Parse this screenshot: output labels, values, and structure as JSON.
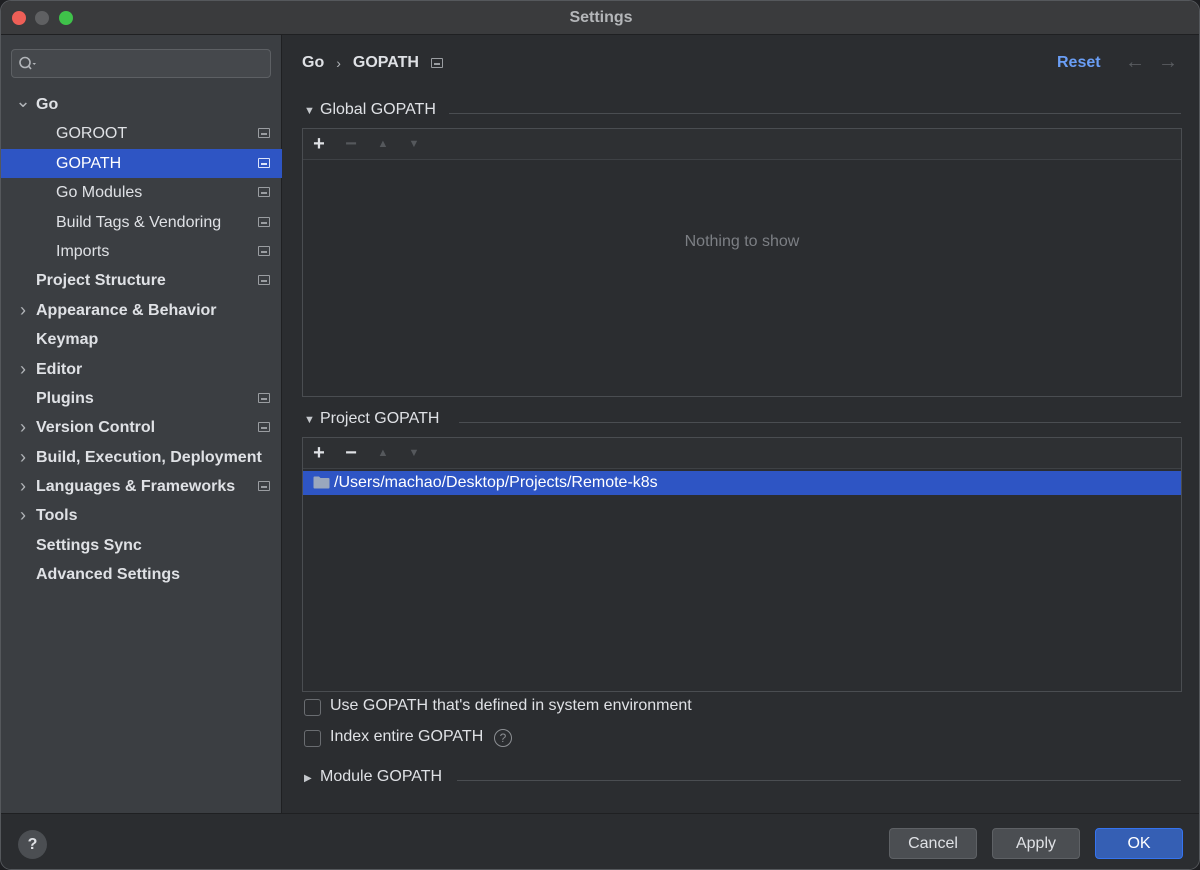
{
  "window": {
    "title": "Settings"
  },
  "sidebar": {
    "search": {
      "value": "",
      "placeholder": ""
    },
    "tree": [
      {
        "label": "Go",
        "bold": true,
        "expander": "expanded",
        "level": 0
      },
      {
        "label": "GOROOT",
        "bold": false,
        "level": 1,
        "project_icon": true
      },
      {
        "label": "GOPATH",
        "bold": false,
        "level": 1,
        "project_icon": true,
        "selected": true
      },
      {
        "label": "Go Modules",
        "bold": false,
        "level": 1,
        "project_icon": true
      },
      {
        "label": "Build Tags & Vendoring",
        "bold": false,
        "level": 1,
        "project_icon": true
      },
      {
        "label": "Imports",
        "bold": false,
        "level": 1,
        "project_icon": true
      },
      {
        "label": "Project Structure",
        "bold": true,
        "level": 0,
        "project_icon": true
      },
      {
        "label": "Appearance & Behavior",
        "bold": true,
        "expander": "collapsed",
        "level": 0
      },
      {
        "label": "Keymap",
        "bold": true,
        "level": 0
      },
      {
        "label": "Editor",
        "bold": true,
        "expander": "collapsed",
        "level": 0
      },
      {
        "label": "Plugins",
        "bold": true,
        "level": 0,
        "project_icon": true
      },
      {
        "label": "Version Control",
        "bold": true,
        "expander": "collapsed",
        "level": 0,
        "project_icon": true
      },
      {
        "label": "Build, Execution, Deployment",
        "bold": true,
        "expander": "collapsed",
        "level": 0
      },
      {
        "label": "Languages & Frameworks",
        "bold": true,
        "expander": "collapsed",
        "level": 0,
        "project_icon": true
      },
      {
        "label": "Tools",
        "bold": true,
        "expander": "collapsed",
        "level": 0
      },
      {
        "label": "Settings Sync",
        "bold": true,
        "level": 0
      },
      {
        "label": "Advanced Settings",
        "bold": true,
        "level": 0
      }
    ]
  },
  "breadcrumb": {
    "parent": "Go",
    "separator": "›",
    "current": "GOPATH"
  },
  "header": {
    "reset_label": "Reset",
    "back_arrow": "←",
    "forward_arrow": "→"
  },
  "global_gopath": {
    "title": "Global GOPATH",
    "expanded": true,
    "toolbar": {
      "add": "+",
      "remove": "−",
      "up": "▲",
      "down": "▼"
    },
    "empty_text": "Nothing to show",
    "entries": []
  },
  "project_gopath": {
    "title": "Project GOPATH",
    "expanded": true,
    "toolbar": {
      "add": "+",
      "remove": "−",
      "up": "▲",
      "down": "▼"
    },
    "entries": [
      "/Users/machao/Desktop/Projects/Remote-k8s"
    ]
  },
  "options": {
    "use_system_gopath": {
      "label": "Use GOPATH that's defined in system environment",
      "checked": false
    },
    "index_entire_gopath": {
      "label": "Index entire GOPATH",
      "checked": false,
      "help": "?"
    }
  },
  "module_gopath": {
    "title": "Module GOPATH",
    "expanded": false
  },
  "footer": {
    "help": "?",
    "cancel_label": "Cancel",
    "apply_label": "Apply",
    "ok_label": "OK"
  },
  "colors": {
    "selection": "#2e55c4",
    "accent_link": "#6a9ef5",
    "sidebar_bg": "#3b3e42",
    "content_bg": "#2b2d30"
  },
  "icons": [
    "search-icon",
    "chevron-down-icon",
    "chevron-right-icon",
    "project-scope-icon",
    "folder-icon",
    "help-icon",
    "arrow-left-icon",
    "arrow-right-icon"
  ]
}
